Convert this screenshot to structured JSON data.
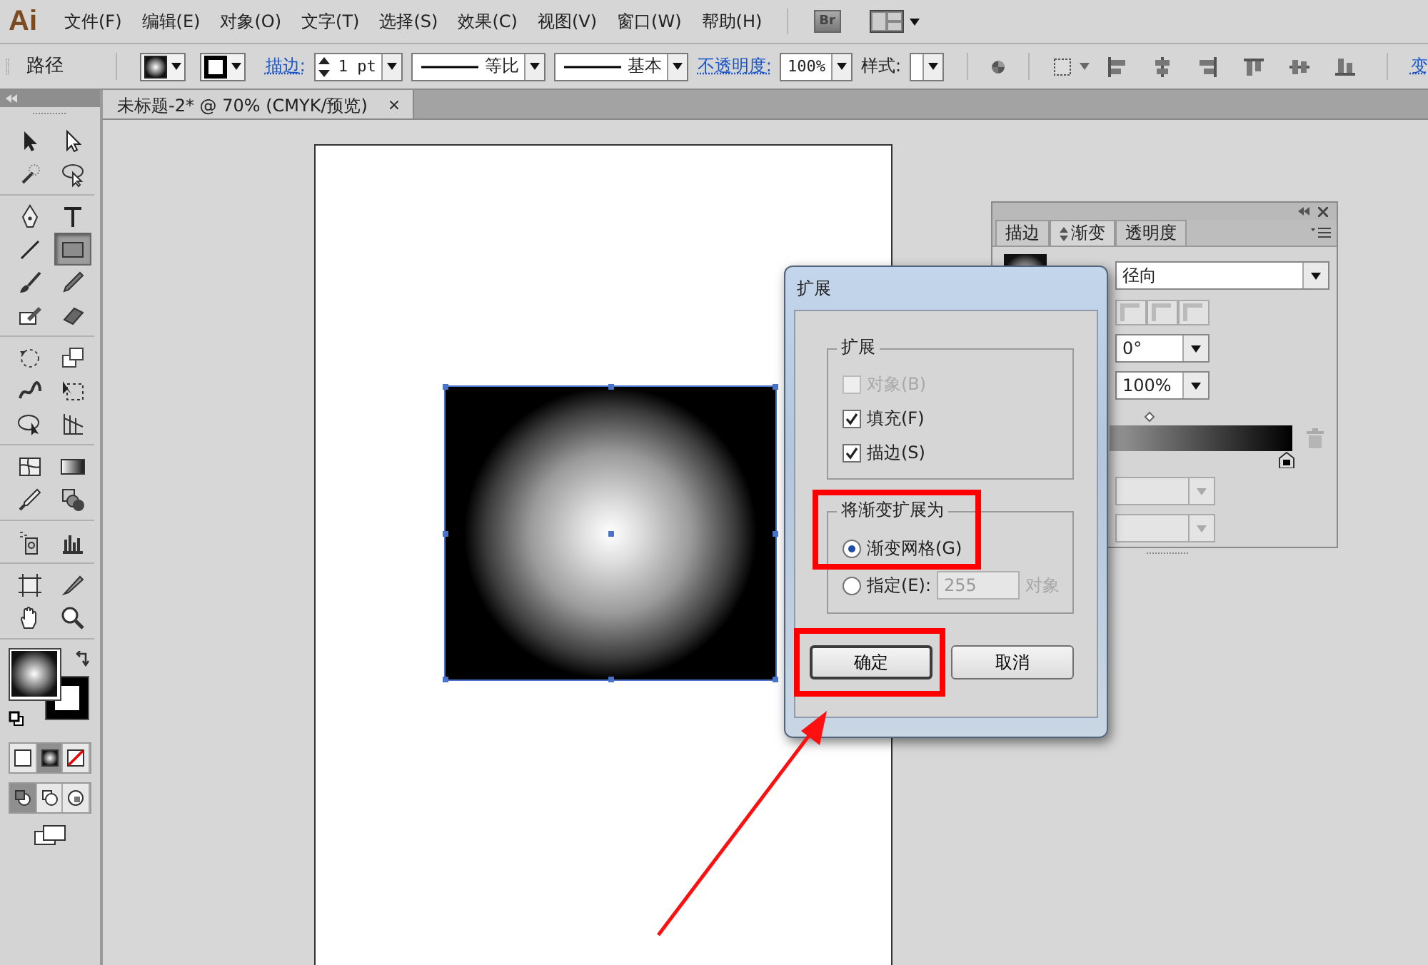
{
  "app_logo": "Ai",
  "menu": [
    "文件(F)",
    "编辑(E)",
    "对象(O)",
    "文字(T)",
    "选择(S)",
    "效果(C)",
    "视图(V)",
    "窗口(W)",
    "帮助(H)"
  ],
  "bridge_button": "Br",
  "control_bar": {
    "selection": "路径",
    "stroke_link": "描边:",
    "stroke_weight": "1 pt",
    "profile": "等比",
    "brush": "基本",
    "opacity_link": "不透明度:",
    "opacity": "100%",
    "style_label": "样式:",
    "transform_link": "变"
  },
  "document_tab": {
    "title": "未标题-2* @ 70% (CMYK/预览)",
    "close": "×"
  },
  "tool_groups": [
    [
      {
        "kind": "selection",
        "selected": false
      },
      {
        "kind": "direct",
        "selected": false
      },
      {
        "kind": "wand",
        "selected": false
      },
      {
        "kind": "lasso",
        "selected": false
      }
    ],
    [
      {
        "kind": "pen",
        "selected": false
      },
      {
        "kind": "type",
        "selected": false
      },
      {
        "kind": "line",
        "selected": false
      },
      {
        "kind": "rect",
        "selected": true
      },
      {
        "kind": "brush",
        "selected": false
      },
      {
        "kind": "pencil",
        "selected": false
      },
      {
        "kind": "blob",
        "selected": false
      },
      {
        "kind": "eraser",
        "selected": false
      }
    ],
    [
      {
        "kind": "rotate",
        "selected": false
      },
      {
        "kind": "scale",
        "selected": false
      },
      {
        "kind": "warp",
        "selected": false
      },
      {
        "kind": "freetransform",
        "selected": false
      },
      {
        "kind": "shapebuilder",
        "selected": false
      },
      {
        "kind": "perspective",
        "selected": false
      }
    ],
    [
      {
        "kind": "mesh",
        "selected": false
      },
      {
        "kind": "gradient",
        "selected": false
      },
      {
        "kind": "eyedropper",
        "selected": false
      },
      {
        "kind": "blend",
        "selected": false
      }
    ],
    [
      {
        "kind": "symbol",
        "selected": false
      },
      {
        "kind": "graph",
        "selected": false
      }
    ],
    [
      {
        "kind": "artboard",
        "selected": false
      },
      {
        "kind": "slice",
        "selected": false
      },
      {
        "kind": "hand",
        "selected": false
      },
      {
        "kind": "zoom",
        "selected": false
      }
    ]
  ],
  "fill_modes": [
    {
      "kind": "color",
      "selected": false
    },
    {
      "kind": "gradient",
      "selected": true
    },
    {
      "kind": "none",
      "selected": false
    }
  ],
  "draw_modes": [
    {
      "kind": "normal",
      "selected": true
    },
    {
      "kind": "behind",
      "selected": false
    },
    {
      "kind": "inside",
      "selected": false
    }
  ],
  "gradient_panel": {
    "tabs": [
      {
        "label": "描边",
        "selected": false
      },
      {
        "label": "渐变",
        "selected": true
      },
      {
        "label": "透明度",
        "selected": false
      }
    ],
    "type": "径向",
    "angle": "0°",
    "aspect_ratio": "100%"
  },
  "dialog": {
    "title": "扩展",
    "expand_group": {
      "legend": "扩展",
      "options": [
        {
          "label": "对象(B)",
          "checked": false,
          "disabled": true
        },
        {
          "label": "填充(F)",
          "checked": true,
          "disabled": false
        },
        {
          "label": "描边(S)",
          "checked": true,
          "disabled": false
        }
      ]
    },
    "gradient_group": {
      "legend": "将渐变扩展为",
      "options": [
        {
          "label": "渐变网格(G)",
          "selected": true
        },
        {
          "label": "指定(E):",
          "selected": false,
          "value": "255",
          "unit": "对象"
        }
      ]
    },
    "buttons": [
      {
        "label": "确定",
        "default": true
      },
      {
        "label": "取消",
        "default": false
      }
    ]
  }
}
